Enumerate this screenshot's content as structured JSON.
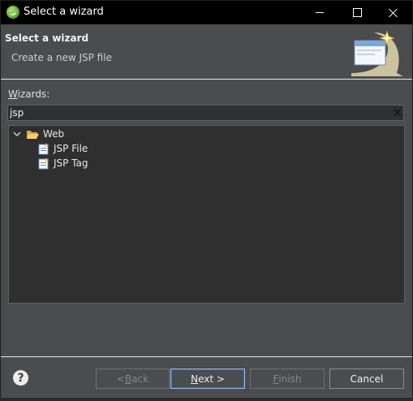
{
  "window": {
    "title": "Select a wizard"
  },
  "banner": {
    "title": "Select a wizard",
    "subtitle": "Create a new JSP file"
  },
  "filter": {
    "label_mnemonic": "W",
    "label_rest": "izards:",
    "value": "jsp"
  },
  "tree": {
    "category": {
      "label": "Web",
      "expanded": true
    },
    "items": [
      {
        "label": "JSP File"
      },
      {
        "label": "JSP Tag"
      }
    ]
  },
  "buttons": {
    "back": {
      "pre": "< ",
      "mnemonic": "B",
      "rest": "ack",
      "enabled": false
    },
    "next": {
      "mnemonic": "N",
      "rest": "ext >",
      "enabled": true
    },
    "finish": {
      "mnemonic": "F",
      "rest": "inish",
      "enabled": false
    },
    "cancel": {
      "label": "Cancel",
      "enabled": true
    }
  },
  "help": {
    "glyph": "?"
  },
  "colors": {
    "dialog_bg": "#4a4c4e",
    "titlebar_bg": "#000000",
    "tree_bg": "#2f2f2f",
    "focus_border": "#9eb8d9"
  }
}
